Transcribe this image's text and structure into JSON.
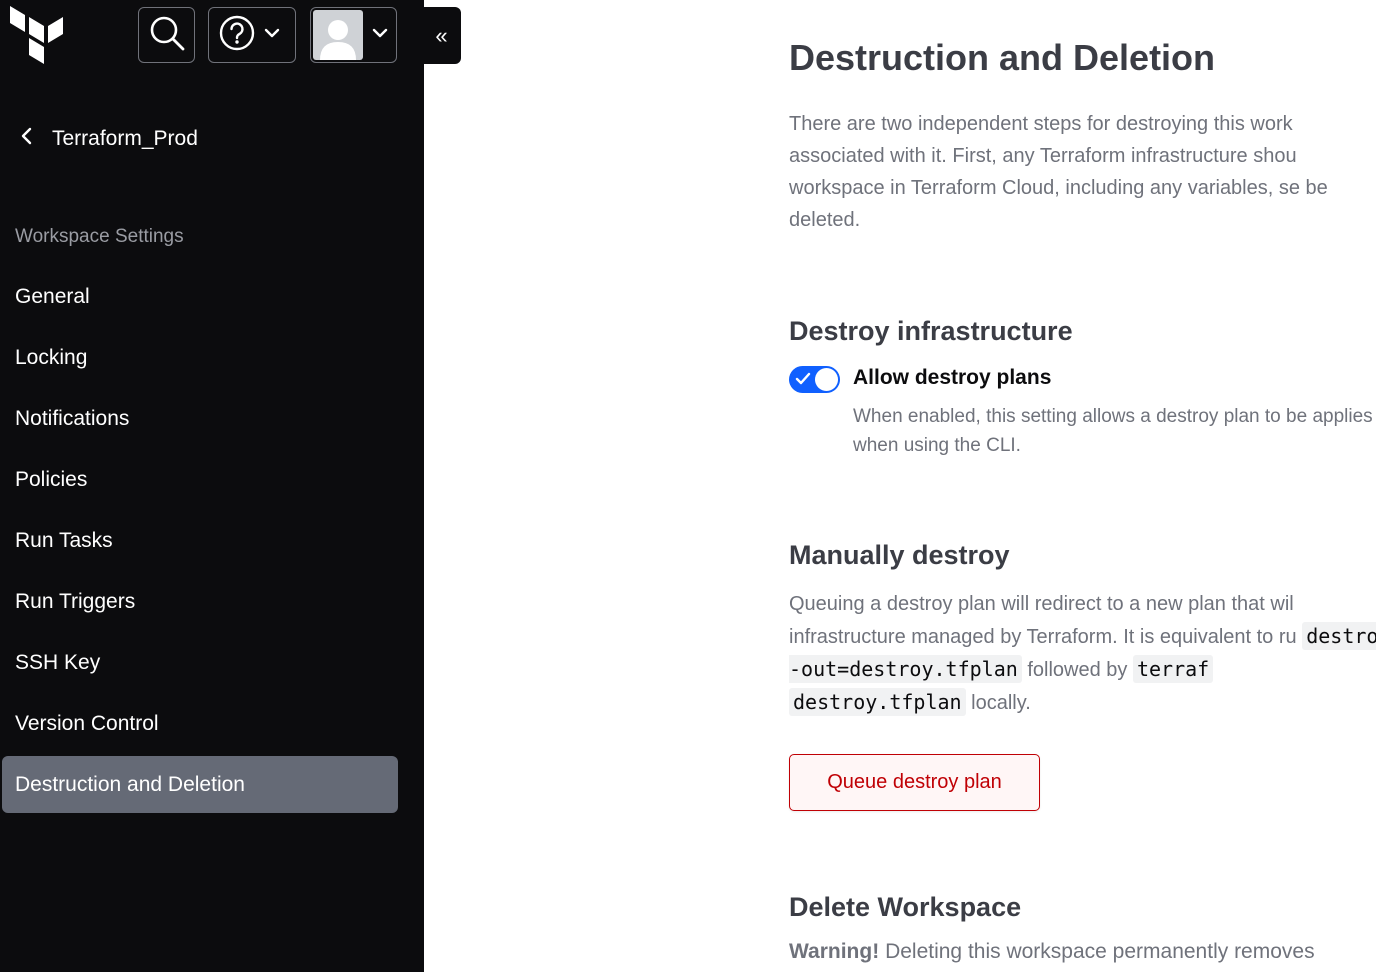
{
  "header": {
    "logo_icon": "terraform-logo",
    "search_icon": "search-icon",
    "help_icon": "help-circle-icon",
    "user_icon": "avatar",
    "collapse_glyph": "«"
  },
  "sidebar": {
    "back_label": "Terraform_Prod",
    "section_label": "Workspace Settings",
    "items": [
      {
        "label": "General"
      },
      {
        "label": "Locking"
      },
      {
        "label": "Notifications"
      },
      {
        "label": "Policies"
      },
      {
        "label": "Run Tasks"
      },
      {
        "label": "Run Triggers"
      },
      {
        "label": "SSH Key"
      },
      {
        "label": "Version Control"
      },
      {
        "label": "Destruction and Deletion",
        "active": true
      }
    ]
  },
  "main": {
    "title": "Destruction and Deletion",
    "intro": "There are two independent steps for destroying this work associated with it. First, any Terraform infrastructure shou workspace in Terraform Cloud, including any variables, se be deleted.",
    "destroy_infra": {
      "heading": "Destroy infrastructure",
      "toggle_label": "Allow destroy plans",
      "toggle_on": true,
      "help": "When enabled, this setting allows a destroy plan to be applies when using the CLI."
    },
    "manual": {
      "heading": "Manually destroy",
      "text1": "Queuing a destroy plan will redirect to a new plan that wil infrastructure managed by Terraform. It is equivalent to ru",
      "code1": "destroy -out=destroy.tfplan",
      "text2": "followed by",
      "code2": "terraf",
      "code3": "destroy.tfplan",
      "text3": "locally.",
      "button": "Queue destroy plan"
    },
    "delete": {
      "heading": "Delete Workspace",
      "warning_bold": "Warning!",
      "warning_text": "Deleting this workspace permanently removes"
    }
  },
  "colors": {
    "sidebar_bg": "#0c0c0e",
    "active_item_bg": "#656a76",
    "toggle_on": "#1060ff",
    "danger": "#c00005"
  }
}
